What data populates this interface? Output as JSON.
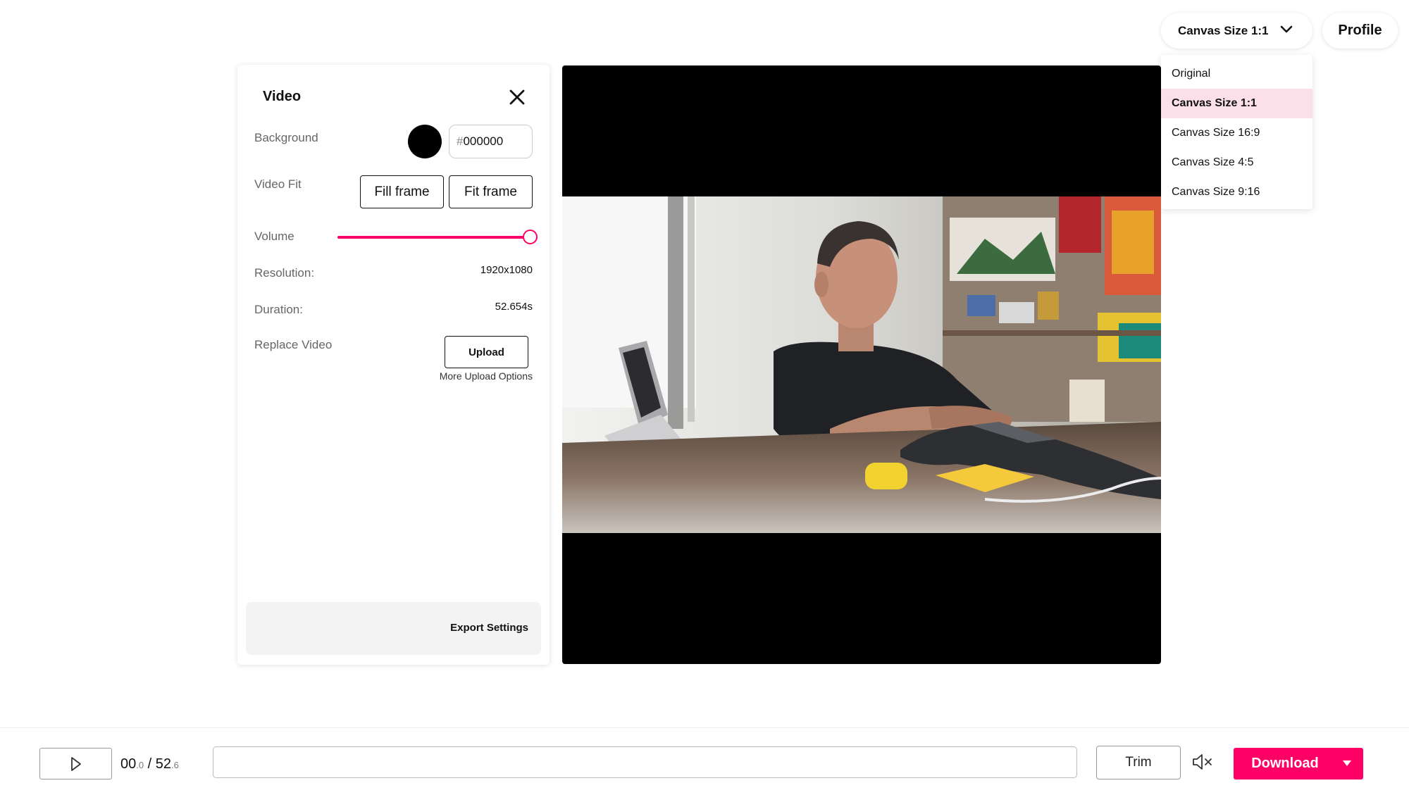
{
  "header": {
    "canvas_select_label": "Canvas Size 1:1",
    "profile_label": "Profile",
    "canvas_options": [
      {
        "label": "Original"
      },
      {
        "label": "Canvas Size 1:1",
        "selected": true
      },
      {
        "label": "Canvas Size 16:9"
      },
      {
        "label": "Canvas Size 4:5"
      },
      {
        "label": "Canvas Size 9:16"
      }
    ]
  },
  "panel": {
    "title": "Video",
    "background_label": "Background",
    "background_color": "#000000",
    "hex_prefix": "#",
    "hex_value": "000000",
    "video_fit_label": "Video Fit",
    "fill_frame_label": "Fill frame",
    "fit_frame_label": "Fit frame",
    "volume_label": "Volume",
    "volume_level": 1.0,
    "resolution_label": "Resolution:",
    "resolution_value": "1920x1080",
    "duration_label": "Duration:",
    "duration_value": "52.654s",
    "replace_video_label": "Replace Video",
    "upload_label": "Upload",
    "more_upload_label": "More Upload Options",
    "export_settings_label": "Export Settings"
  },
  "bottom": {
    "time_current_main": "00",
    "time_current_frac": ".0",
    "time_separator": " / ",
    "time_total_main": "52",
    "time_total_frac": ".6",
    "trim_label": "Trim",
    "download_label": "Download"
  },
  "colors": {
    "accent": "#ff0066",
    "selected_option_bg": "#fbe0ea"
  },
  "icons": [
    "chevron-down-icon",
    "close-icon",
    "play-icon",
    "mute-icon",
    "caret-down-icon"
  ]
}
